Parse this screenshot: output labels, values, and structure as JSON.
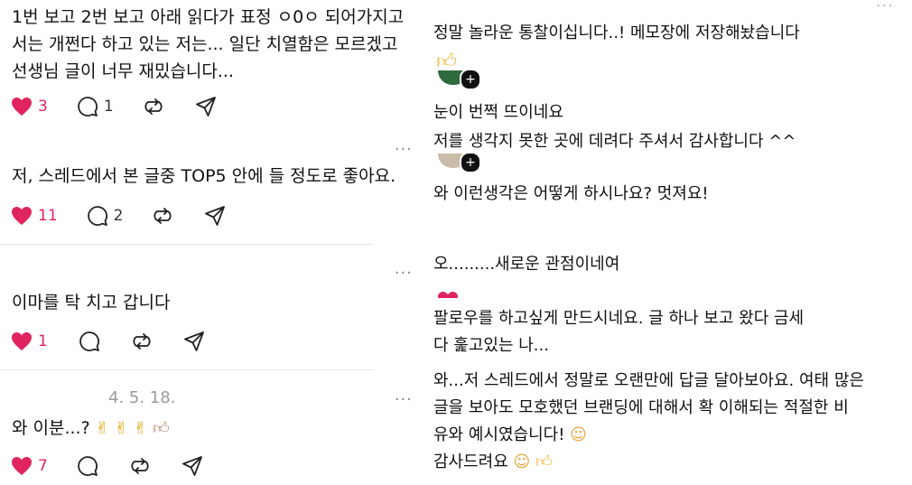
{
  "left_posts": [
    {
      "text_lines": [
        "1번 보고 2번 보고 아래 읽다가 표정 ㅇ0ㅇ 되어가지고",
        "서는 개쩐다 하고 있는 저는... 일단 치열함은 모르겠고",
        "선생님 글이 너무 재밌습니다..."
      ],
      "likes": "3",
      "replies": "1"
    },
    {
      "text_lines": [
        "저, 스레드에서 본 글중 TOP5 안에 들 정도로 좋아요."
      ],
      "likes": "11",
      "replies": "2"
    },
    {
      "text_lines": [
        "이마를 탁 치고 갑니다"
      ],
      "likes": "1",
      "replies": ""
    },
    {
      "date": "4. 5. 18.",
      "text": "와 이분...?",
      "emoji_icons": [
        "crossed-fingers-icon",
        "crossed-fingers-icon",
        "crossed-fingers-icon",
        "thumbs-up-icon"
      ],
      "likes": "7",
      "replies": ""
    }
  ],
  "right_comments": [
    {
      "lines": [
        "정말 놀라운 통찰이십니다..! 메모장에 저장해놨습니다"
      ],
      "emoji": "thumbs-up-icon"
    },
    {
      "lines": [
        "눈이 번쩍 뜨이네요"
      ]
    },
    {
      "lines": [
        "저를 생각지 못한 곳에 데려다 주셔서 감사합니다 ^^"
      ]
    },
    {
      "lines": [
        "와 이런생각은 어떻게 하시나요? 멋져요!"
      ]
    },
    {
      "lines": [
        "오.........새로운 관점이네여"
      ]
    },
    {
      "lines": [
        "팔로우를 하고싶게 만드시네요. 글 하나 보고 왔다 금세",
        "다 훑고있는 나..."
      ]
    },
    {
      "lines": [
        "와...저 스레드에서 정말로 오랜만에 답글 달아보아요. 여태 많은",
        "글을 보아도 모호했던 브랜딩에 대해서 확 이해되는 적절한 비",
        "유와 예시였습니다!",
        "감사드려요"
      ]
    }
  ],
  "colors": {
    "like": "#e0245e",
    "text": "#111111",
    "muted": "#8a8a8a",
    "divider": "#e5e5e5"
  },
  "icons": [
    "heart-icon",
    "comment-icon",
    "repost-icon",
    "share-icon",
    "more-icon"
  ],
  "more_label": "···"
}
